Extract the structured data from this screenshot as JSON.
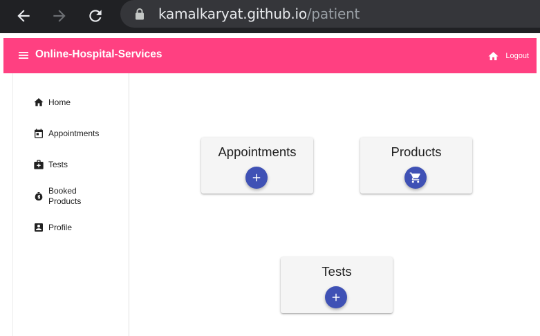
{
  "browser": {
    "url_host": "kamalkaryat.github.io",
    "url_path": "/patient"
  },
  "app_bar": {
    "title": "Online-Hospital-Services",
    "logout_label": "Logout",
    "color": "#ff4081"
  },
  "sidebar": {
    "items": [
      {
        "label": "Home",
        "icon": "home-icon"
      },
      {
        "label": "Appointments",
        "icon": "calendar-icon"
      },
      {
        "label": "Tests",
        "icon": "medical-bag-icon"
      },
      {
        "label": "Booked Products",
        "icon": "bag-icon"
      },
      {
        "label": "Profile",
        "icon": "account-box-icon"
      }
    ]
  },
  "cards": [
    {
      "title": "Appointments",
      "action_icon": "plus-icon"
    },
    {
      "title": "Products",
      "action_icon": "cart-icon"
    },
    {
      "title": "Tests",
      "action_icon": "plus-icon"
    }
  ],
  "colors": {
    "accent": "#ff4081",
    "fab": "#3f51b5",
    "card_bg": "#f5f5f5"
  }
}
